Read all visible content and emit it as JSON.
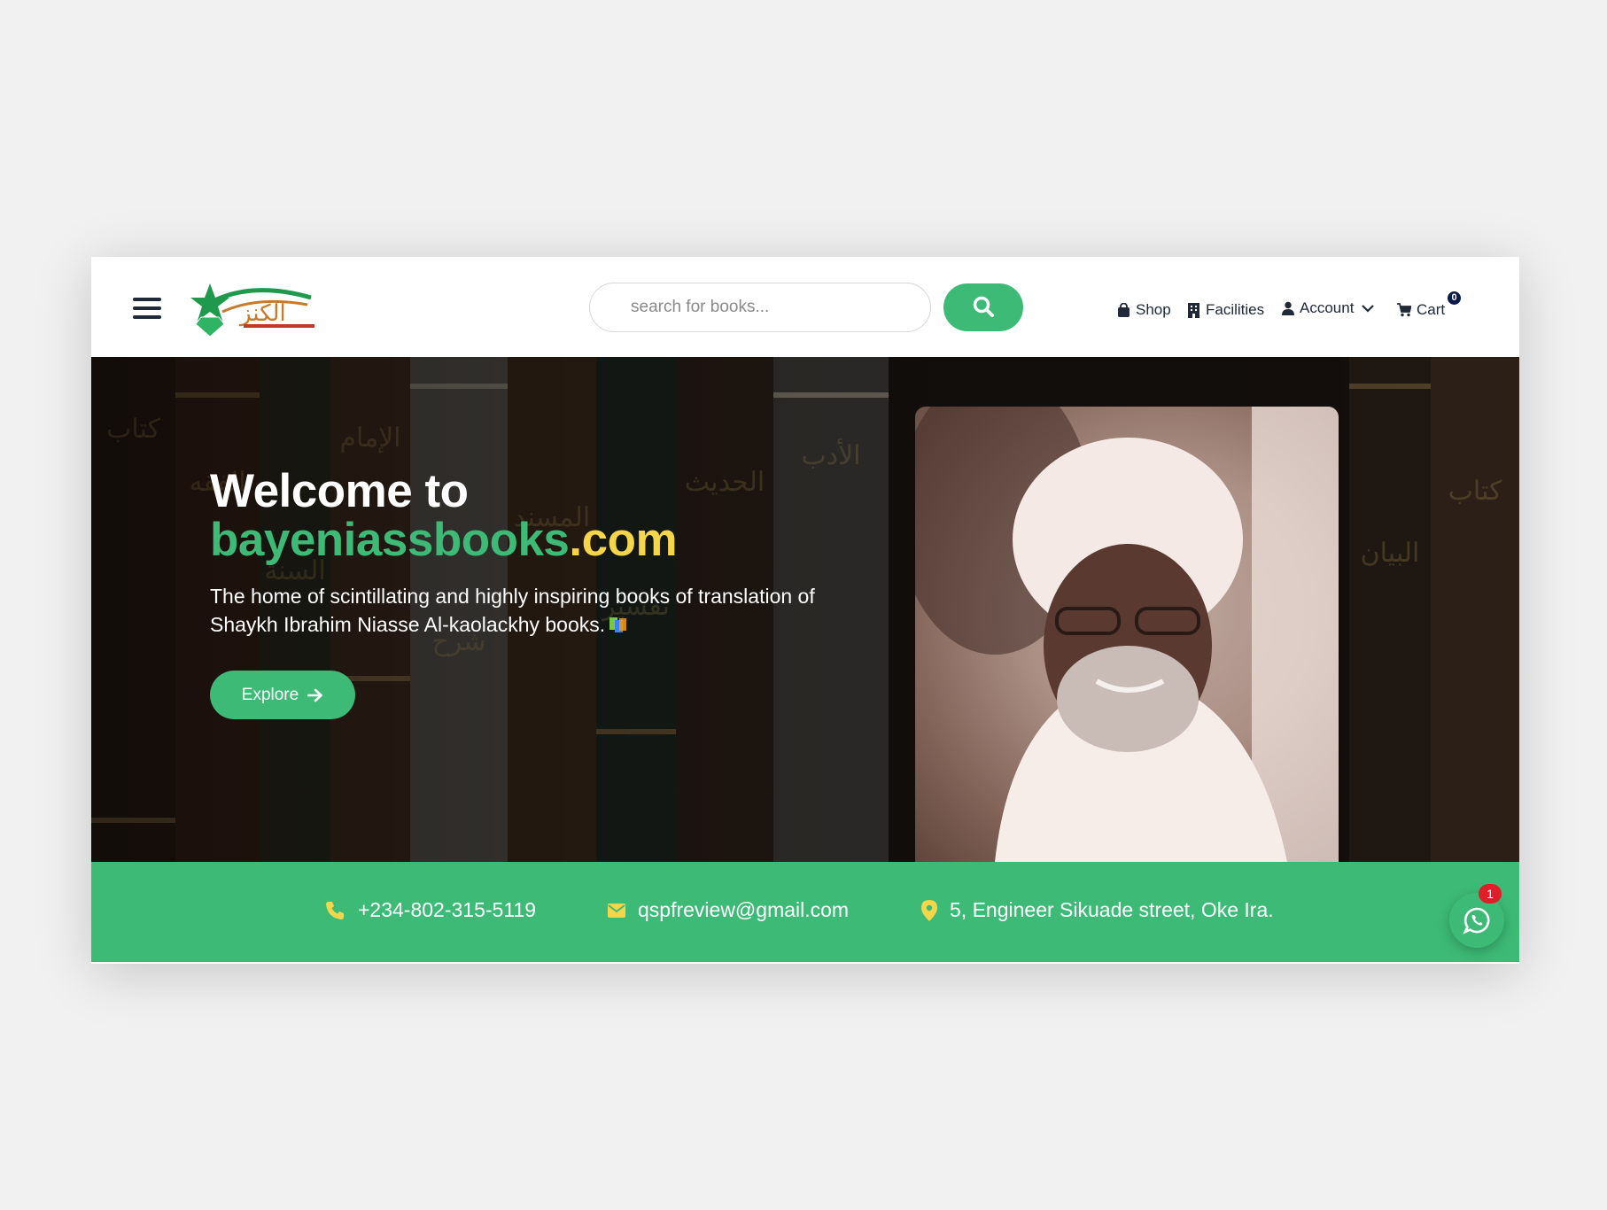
{
  "header": {
    "search": {
      "placeholder": "search for books...",
      "value": ""
    },
    "nav": {
      "shop": "Shop",
      "facilities": "Facilities",
      "account": "Account",
      "cart": "Cart",
      "cart_count": "0"
    }
  },
  "hero": {
    "title_line1": "Welcome to",
    "title_brand": "bayeniassbooks",
    "title_tld": ".com",
    "subtitle": "The home of scintillating and highly inspiring books of translation of Shaykh Ibrahim Niasse Al-kaolackhy books.",
    "explore_label": "Explore"
  },
  "contact": {
    "phone": "+234-802-315-5119",
    "email": "qspfreview@gmail.com",
    "address": "5, Engineer Sikuade street, Oke Ira."
  },
  "whatsapp": {
    "badge": "1"
  },
  "colors": {
    "brand_green": "#3dbb76",
    "accent_yellow": "#f5d64a",
    "badge_red": "#e11d2a",
    "nav_text": "#1f2937"
  },
  "icons": [
    "menu-icon",
    "logo-star-icon",
    "search-icon",
    "shopping-bag-icon",
    "building-icon",
    "user-icon",
    "chevron-down-icon",
    "cart-icon",
    "arrow-right-icon",
    "books-icon",
    "phone-icon",
    "mail-icon",
    "location-pin-icon",
    "whatsapp-icon"
  ]
}
